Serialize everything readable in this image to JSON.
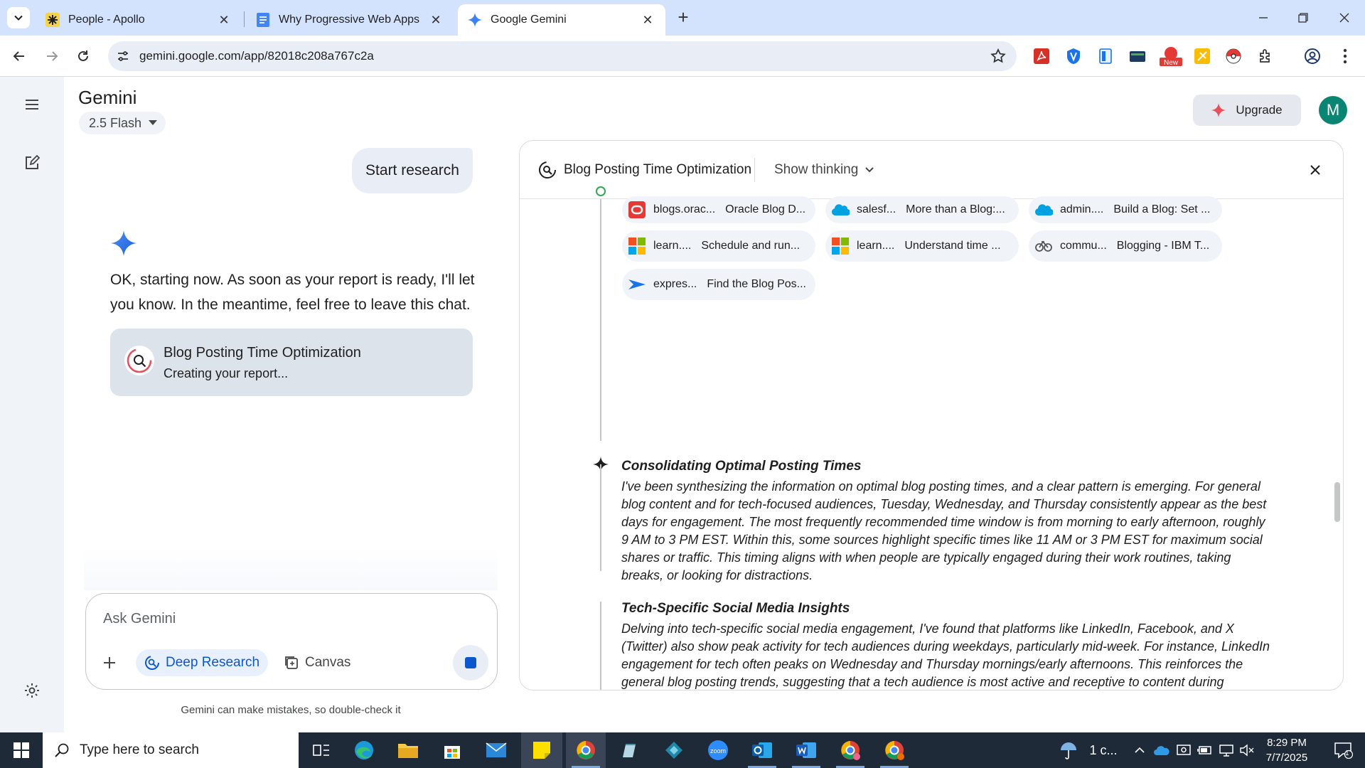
{
  "browser": {
    "tabs": [
      {
        "title": "People - Apollo"
      },
      {
        "title": "Why Progressive Web Apps (PV"
      },
      {
        "title": "Google Gemini"
      }
    ],
    "url": "gemini.google.com/app/82018c208a767c2a"
  },
  "app": {
    "name": "Gemini",
    "model": "2.5 Flash",
    "upgrade_label": "Upgrade",
    "avatar_letter": "M"
  },
  "chat": {
    "user_message": "Start research",
    "ai_message": "OK, starting now. As soon as your report is ready, I'll let you know. In the meantime, feel free to leave this chat.",
    "report": {
      "title": "Blog Posting Time Optimization",
      "status": "Creating your report..."
    },
    "input": {
      "placeholder": "Ask Gemini",
      "deep_research_label": "Deep Research",
      "canvas_label": "Canvas"
    },
    "disclaimer": "Gemini can make mistakes, so double-check it"
  },
  "panel": {
    "title": "Blog Posting Time Optimization",
    "show_thinking_label": "Show thinking",
    "sources": [
      {
        "icon": "oracle-icon",
        "domain": "blogs.orac...",
        "title": "Oracle Blog D..."
      },
      {
        "icon": "salesforce-icon",
        "domain": "salesf...",
        "title": "More than a Blog:..."
      },
      {
        "icon": "salesforce-icon",
        "domain": "admin....",
        "title": "Build a Blog: Set ..."
      },
      {
        "icon": "microsoft-icon",
        "domain": "learn....",
        "title": "Schedule and run..."
      },
      {
        "icon": "microsoft-icon",
        "domain": "learn....",
        "title": "Understand time ..."
      },
      {
        "icon": "ibm-icon",
        "domain": "commu...",
        "title": "Blogging - IBM T..."
      },
      {
        "icon": "express-icon",
        "domain": "expres...",
        "title": "Find the Blog Pos..."
      }
    ],
    "steps": [
      {
        "title": "Consolidating Optimal Posting Times",
        "body": "I've been synthesizing the information on optimal blog posting times, and a clear pattern is emerging. For general blog content and for tech-focused audiences, Tuesday, Wednesday, and Thursday consistently appear as the best days for engagement. The most frequently recommended time window is from morning to early afternoon, roughly 9 AM to 3 PM EST. Within this, some sources highlight specific times like 11 AM or 3 PM EST for maximum social shares or traffic. This timing aligns with when people are typically engaged during their work routines, taking breaks, or looking for distractions."
      },
      {
        "title": "Tech-Specific Social Media Insights",
        "body": "Delving into tech-specific social media engagement, I've found that platforms like LinkedIn, Facebook, and X (Twitter) also show peak activity for tech audiences during weekdays, particularly mid-week. For instance, LinkedIn engagement for tech often peaks on Wednesday and Thursday mornings/early afternoons. This reinforces the general blog posting trends, suggesting that a tech audience is most active and receptive to content during"
      }
    ]
  },
  "taskbar": {
    "search_placeholder": "Type here to search",
    "weather": "1 c...",
    "time": "8:29 PM",
    "date": "7/7/2025",
    "notification_count": "1"
  },
  "colors": {
    "tabstrip": "#d3e3fd",
    "accent_blue": "#0b57d0",
    "avatar": "#0a8574",
    "taskbar": "#1f2a38"
  }
}
